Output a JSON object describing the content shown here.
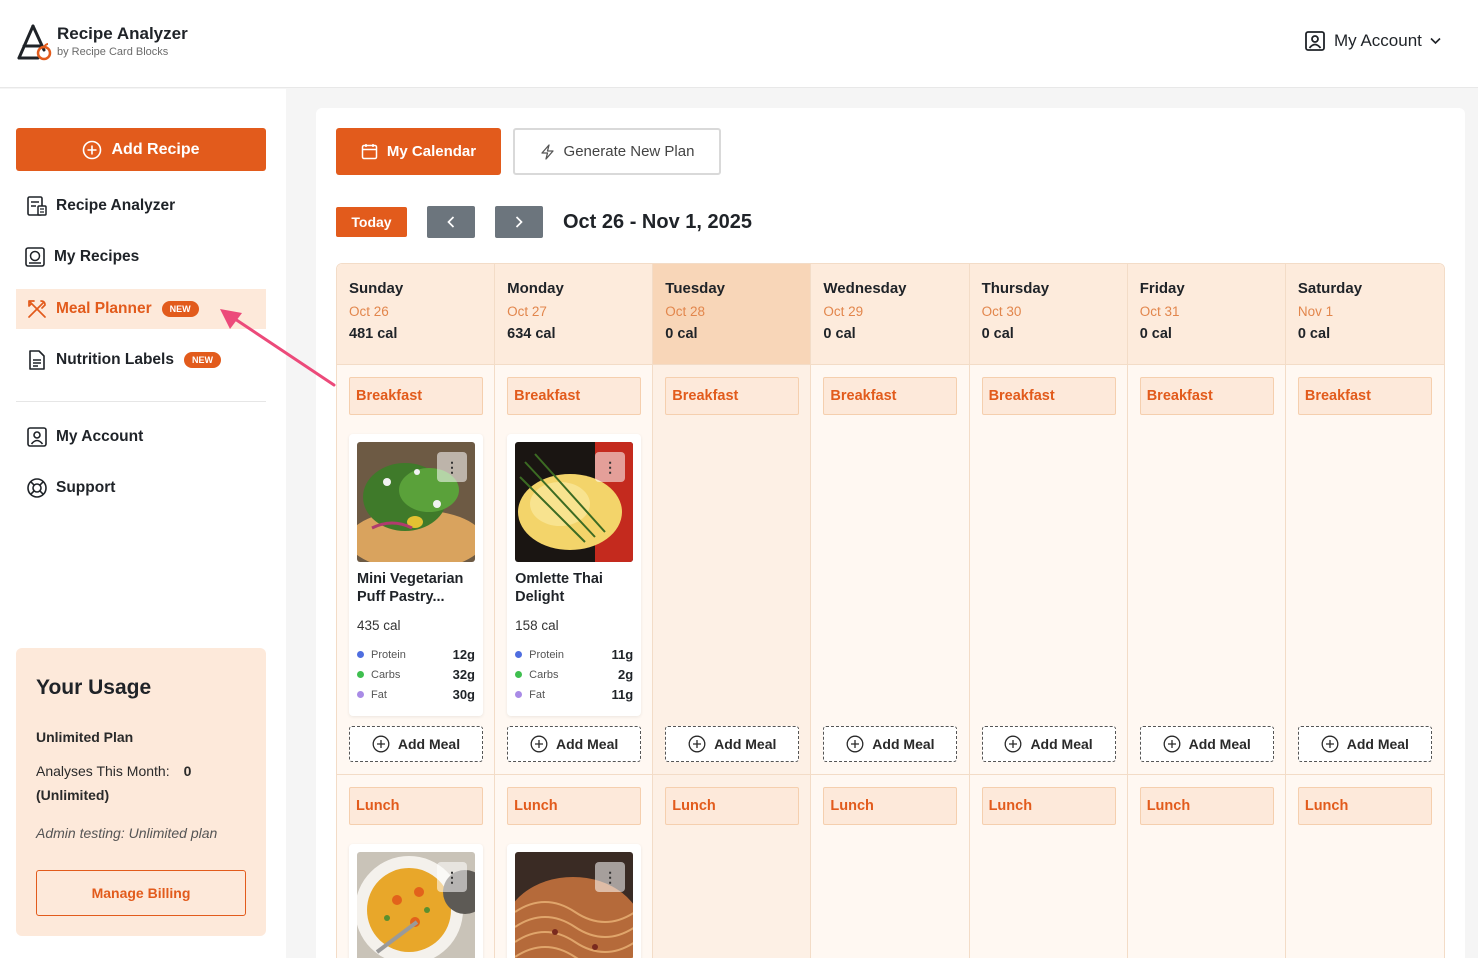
{
  "brand": {
    "title": "Recipe Analyzer",
    "subtitle": "by Recipe Card Blocks"
  },
  "header": {
    "account_label": "My Account"
  },
  "sidebar": {
    "add_recipe": "Add Recipe",
    "items": [
      {
        "label": "Recipe Analyzer"
      },
      {
        "label": "My Recipes"
      },
      {
        "label": "Meal Planner",
        "badge": "NEW"
      },
      {
        "label": "Nutrition Labels",
        "badge": "NEW"
      },
      {
        "label": "My Account"
      },
      {
        "label": "Support"
      }
    ]
  },
  "usage": {
    "title": "Your Usage",
    "plan": "Unlimited Plan",
    "analyses_label": "Analyses This Month:",
    "analyses_value": "0",
    "analyses_note": "(Unlimited)",
    "admin_note": "Admin testing: Unlimited plan",
    "billing_button": "Manage Billing"
  },
  "toolbar": {
    "calendar": "My Calendar",
    "generate": "Generate New Plan",
    "today": "Today",
    "range": "Oct 26 - Nov 1, 2025"
  },
  "slots": {
    "breakfast": "Breakfast",
    "lunch": "Lunch",
    "add_meal": "Add Meal"
  },
  "days": [
    {
      "name": "Sunday",
      "date": "Oct 26",
      "cal": "481 cal"
    },
    {
      "name": "Monday",
      "date": "Oct 27",
      "cal": "634 cal"
    },
    {
      "name": "Tuesday",
      "date": "Oct 28",
      "cal": "0 cal"
    },
    {
      "name": "Wednesday",
      "date": "Oct 29",
      "cal": "0 cal"
    },
    {
      "name": "Thursday",
      "date": "Oct 30",
      "cal": "0 cal"
    },
    {
      "name": "Friday",
      "date": "Oct 31",
      "cal": "0 cal"
    },
    {
      "name": "Saturday",
      "date": "Nov 1",
      "cal": "0 cal"
    }
  ],
  "meals": {
    "sunday_breakfast": {
      "title": "Mini Vegetarian Puff Pastry...",
      "cal": "435 cal",
      "protein": "12g",
      "carbs": "32g",
      "fat": "30g"
    },
    "monday_breakfast": {
      "title": "Omlette Thai Delight",
      "cal": "158 cal",
      "protein": "11g",
      "carbs": "2g",
      "fat": "11g"
    }
  },
  "macro_labels": {
    "protein": "Protein",
    "carbs": "Carbs",
    "fat": "Fat"
  },
  "colors": {
    "accent": "#e25b1c",
    "protein": "#4f6ee0",
    "carbs": "#3fbf4f",
    "fat": "#a98be6",
    "arrow": "#ec4a7a"
  }
}
